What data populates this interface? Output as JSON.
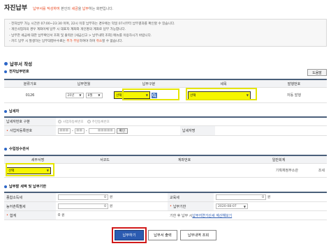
{
  "page": {
    "title": "자진납부",
    "desc_hl1": "납부서를 작성하여",
    "desc_mid1": " 본인의 ",
    "desc_hl2": "세금",
    "desc_mid2": "을 ",
    "desc_hl3": "납부",
    "desc_end": "하는 화면입니다."
  },
  "notice": {
    "line1": "전자납부 가능 시간은 07:00~23:30 이며, 22시 이후 납부하는 경우에는 익일 07시부터 납부결과를 확인할 수 있습니다.",
    "line2": "개인사업자의 경우 계좌이체 납부 시 대표자 계좌와 개인명의 계좌로 납부 가능합니다.",
    "line3": "납부한 세금에 대한 납부확인서 조회 및 출력은 [세금신고 > 납부내역 조회] 메뉴를 이용하시기 바랍니다.",
    "line4_pre": "카드 납부 시 발생하는 납부대행수수료는 ",
    "line4_hl1": "추가 부담",
    "line4_mid": "하여야 하며 ",
    "line4_hl2": "취소",
    "line4_end": "할 수 없습니다."
  },
  "section_main": "납부서 작성",
  "help_button": "도움말",
  "electronic": {
    "title": "전자납부번호",
    "headers": [
      "분류기호",
      "납부연월",
      "납부구분",
      "세목",
      "발행번호"
    ],
    "classification_code": "0126",
    "year_value": "20년",
    "month_value": "8월",
    "payment_type_value": "선택",
    "tax_item_value": "선택",
    "issue_label": "자동 발행"
  },
  "taxpayer": {
    "title": "납세자",
    "type_label": "납세자번호 구분",
    "radio_business": "사업자등록번호",
    "radio_resident": "주민등록번호",
    "bizno_label": "사업자등록번호",
    "bizno_parts": [
      "■■■",
      "■■",
      "■■■■■"
    ],
    "confirm_button": "확인",
    "name_label": "납세자명"
  },
  "office": {
    "title": "수입징수관서",
    "headers": [
      "세무서명",
      "서코드",
      "계좌번호",
      "일반회계"
    ],
    "office_select": "선택",
    "account_holder": "기획재정부소관",
    "account_type": "조세"
  },
  "amount": {
    "title": "납부할 세액 및 납부기한",
    "income_tax_label": "종합소득세",
    "income_tax_value": "0",
    "education_tax_label": "교육세",
    "education_tax_value": "0",
    "rural_tax_label": "농어촌특별세",
    "rural_tax_value": "0",
    "due_label": "납부기한",
    "due_value": "2020-08-07",
    "total_label": "합계",
    "total_value": "0",
    "unit": "원",
    "deadline_note_pre": "기한 후 납부 시 ",
    "deadline_note_link": "납부지연가산세 계산해보기"
  },
  "buttons": {
    "pay": "납부하기",
    "print": "납부서 출력",
    "history": "납부내역 조회"
  },
  "colors": {
    "accent_blue": "#2b5bb1",
    "highlight_yellow": "#f6f600",
    "alert_red": "#d11a1a",
    "text_orange": "#e8461e"
  }
}
